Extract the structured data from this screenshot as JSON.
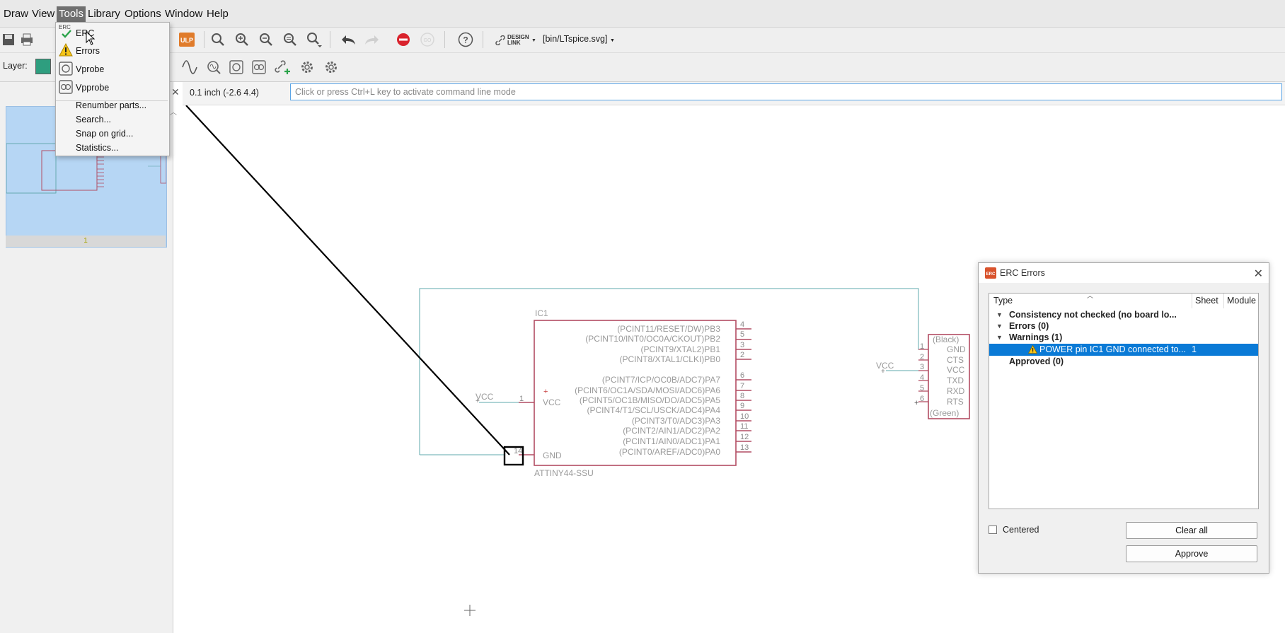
{
  "menubar": {
    "items": [
      "Draw",
      "View",
      "Tools",
      "Library",
      "Options",
      "Window",
      "Help"
    ],
    "active": "Tools"
  },
  "toolbar": {
    "design_link_label": "DESIGN LINK",
    "current_file": "[bin/LTspice.svg]",
    "ulp_label": "ULP",
    "layer_label": "Layer:"
  },
  "tools_menu": {
    "items": [
      {
        "label": "ERC",
        "icon": "erc-check-icon"
      },
      {
        "label": "Errors",
        "icon": "warning-icon"
      },
      {
        "label": "Vprobe",
        "icon": "vprobe-icon"
      },
      {
        "label": "Vpprobe",
        "icon": "vpprobe-icon"
      },
      {
        "label": "Renumber parts..."
      },
      {
        "label": "Search..."
      },
      {
        "label": "Snap on grid..."
      },
      {
        "label": "Statistics..."
      }
    ],
    "erc_badge": "ERC"
  },
  "status": {
    "coordinates": "0.1 inch (-2.6 4.4)",
    "command_placeholder": "Click or press Ctrl+L key to activate command line mode"
  },
  "left_panel": {
    "sheet_number": "1"
  },
  "schematic": {
    "ic": {
      "name": "IC1",
      "value": "ATTINY44-SSU",
      "left_pins": [
        {
          "num": "1",
          "name": "VCC",
          "net": "VCC"
        },
        {
          "num": "14",
          "name": "GND"
        }
      ],
      "right_pins": [
        {
          "label": "(PCINT11/RESET/DW)PB3",
          "num": "4"
        },
        {
          "label": "(PCINT10/INT0/OC0A/CKOUT)PB2",
          "num": "5"
        },
        {
          "label": "(PCINT9/XTAL2)PB1",
          "num": "3"
        },
        {
          "label": "(PCINT8/XTAL1/CLKI)PB0",
          "num": "2"
        },
        {
          "label": "(PCINT7/ICP/OC0B/ADC7)PA7",
          "num": "6"
        },
        {
          "label": "(PCINT6/OC1A/SDA/MOSI/ADC6)PA6",
          "num": "7"
        },
        {
          "label": "(PCINT5/OC1B/MISO/DO/ADC5)PA5",
          "num": "8"
        },
        {
          "label": "(PCINT4/T1/SCL/USCK/ADC4)PA4",
          "num": "9"
        },
        {
          "label": "(PCINT3/T0/ADC3)PA3",
          "num": "10"
        },
        {
          "label": "(PCINT2/AIN1/ADC2)PA2",
          "num": "11"
        },
        {
          "label": "(PCINT1/AIN0/ADC1)PA1",
          "num": "12"
        },
        {
          "label": "(PCINT0/AREF/ADC0)PA0",
          "num": "13"
        }
      ]
    },
    "connector": {
      "top_label": "(Black)",
      "bottom_label": "(Green)",
      "net_label": "VCC",
      "pins": [
        {
          "num": "1",
          "name": "GND"
        },
        {
          "num": "2",
          "name": "CTS"
        },
        {
          "num": "3",
          "name": "VCC"
        },
        {
          "num": "4",
          "name": "TXD"
        },
        {
          "num": "5",
          "name": "RXD"
        },
        {
          "num": "6",
          "name": "RTS"
        }
      ]
    }
  },
  "erc_dialog": {
    "title": "ERC Errors",
    "columns": [
      "Type",
      "Sheet",
      "Module"
    ],
    "rows": [
      {
        "label": "Consistency not checked (no board lo...",
        "expanded": true
      },
      {
        "label": "Errors (0)",
        "expanded": true
      },
      {
        "label": "Warnings (1)",
        "expanded": true
      },
      {
        "label": "POWER pin IC1 GND connected to...",
        "sheet": "1",
        "selected": true
      },
      {
        "label": "Approved (0)"
      }
    ],
    "centered_label": "Centered",
    "clear_all_label": "Clear all",
    "approve_label": "Approve"
  }
}
